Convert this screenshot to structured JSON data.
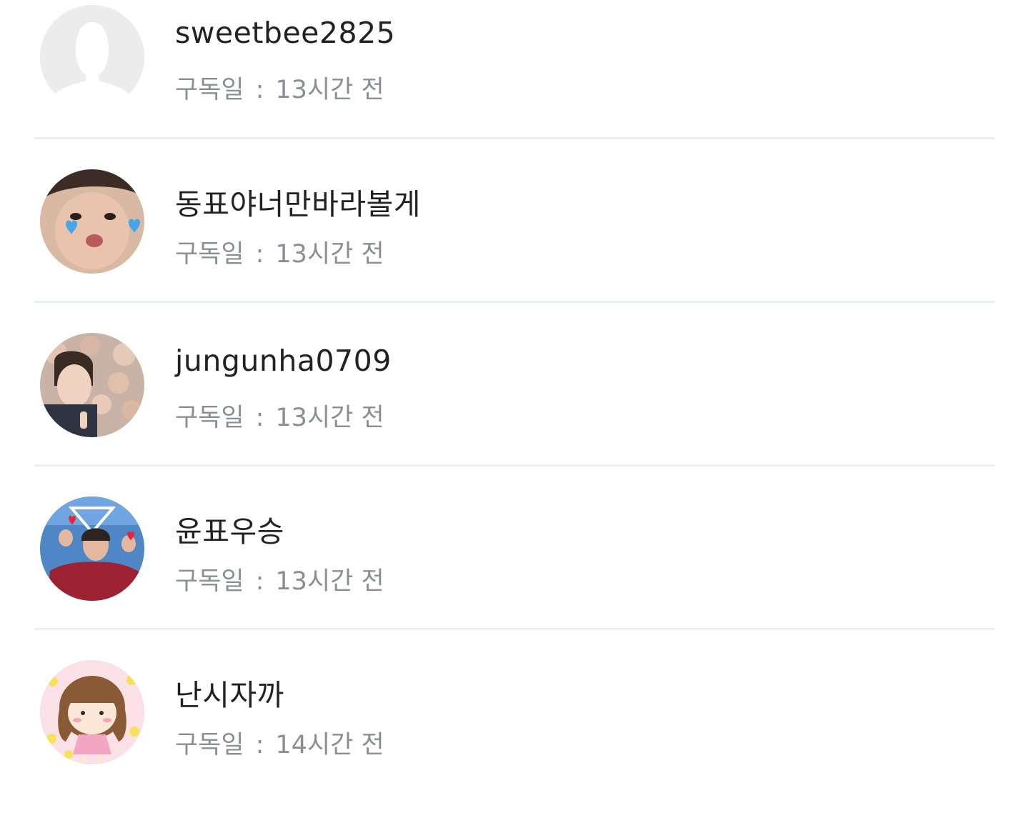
{
  "subscribers": [
    {
      "username": "sweetbee2825",
      "label": "구독일",
      "separator": ":",
      "time": "13시간 전",
      "avatar": "default-person-icon"
    },
    {
      "username": "동표야너만바라볼게",
      "label": "구독일",
      "separator": ":",
      "time": "13시간 전",
      "avatar": "profile-photo"
    },
    {
      "username": "jungunha0709",
      "label": "구독일",
      "separator": ":",
      "time": "13시간 전",
      "avatar": "profile-photo"
    },
    {
      "username": "윤표우승",
      "label": "구독일",
      "separator": ":",
      "time": "13시간 전",
      "avatar": "profile-photo"
    },
    {
      "username": "난시자까",
      "label": "구독일",
      "separator": ":",
      "time": "14시간 전",
      "avatar": "profile-illustration"
    }
  ],
  "colors": {
    "username": "#222222",
    "meta": "#8a8f96",
    "divider": "#eef1f3",
    "default_avatar_bg": "#ececec"
  }
}
